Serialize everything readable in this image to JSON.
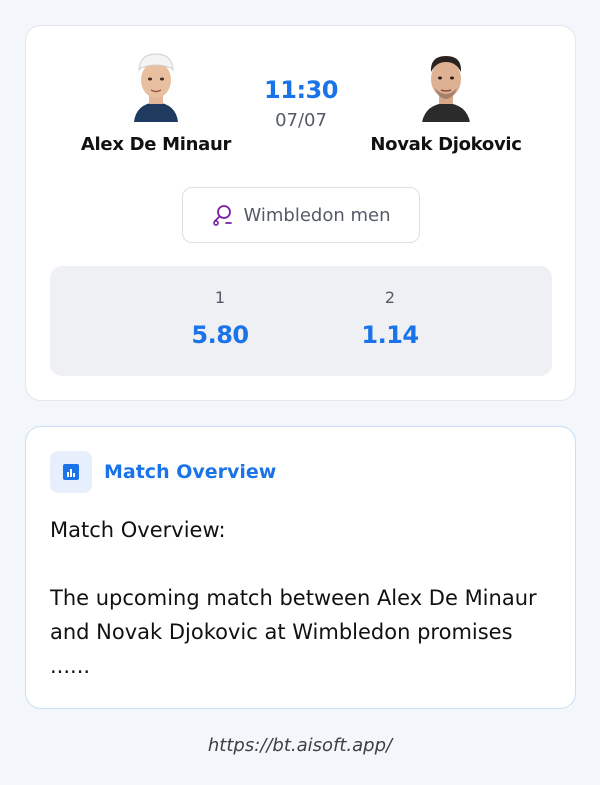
{
  "match": {
    "player1": {
      "name": "Alex De Minaur"
    },
    "player2": {
      "name": "Novak Djokovic"
    },
    "time": "11:30",
    "date": "07/07",
    "tournament": "Wimbledon men",
    "odds": [
      {
        "label": "1",
        "value": "5.80"
      },
      {
        "label": "2",
        "value": "1.14"
      }
    ]
  },
  "overview": {
    "title": "Match Overview",
    "heading": "Match Overview:",
    "text": "The upcoming match between Alex De Minaur and Novak Djokovic at Wimbledon promises ......"
  },
  "footer": {
    "url": "https://bt.aisoft.app/"
  },
  "colors": {
    "accent": "#1a73e8",
    "tournament_icon": "#7b1fa2"
  }
}
